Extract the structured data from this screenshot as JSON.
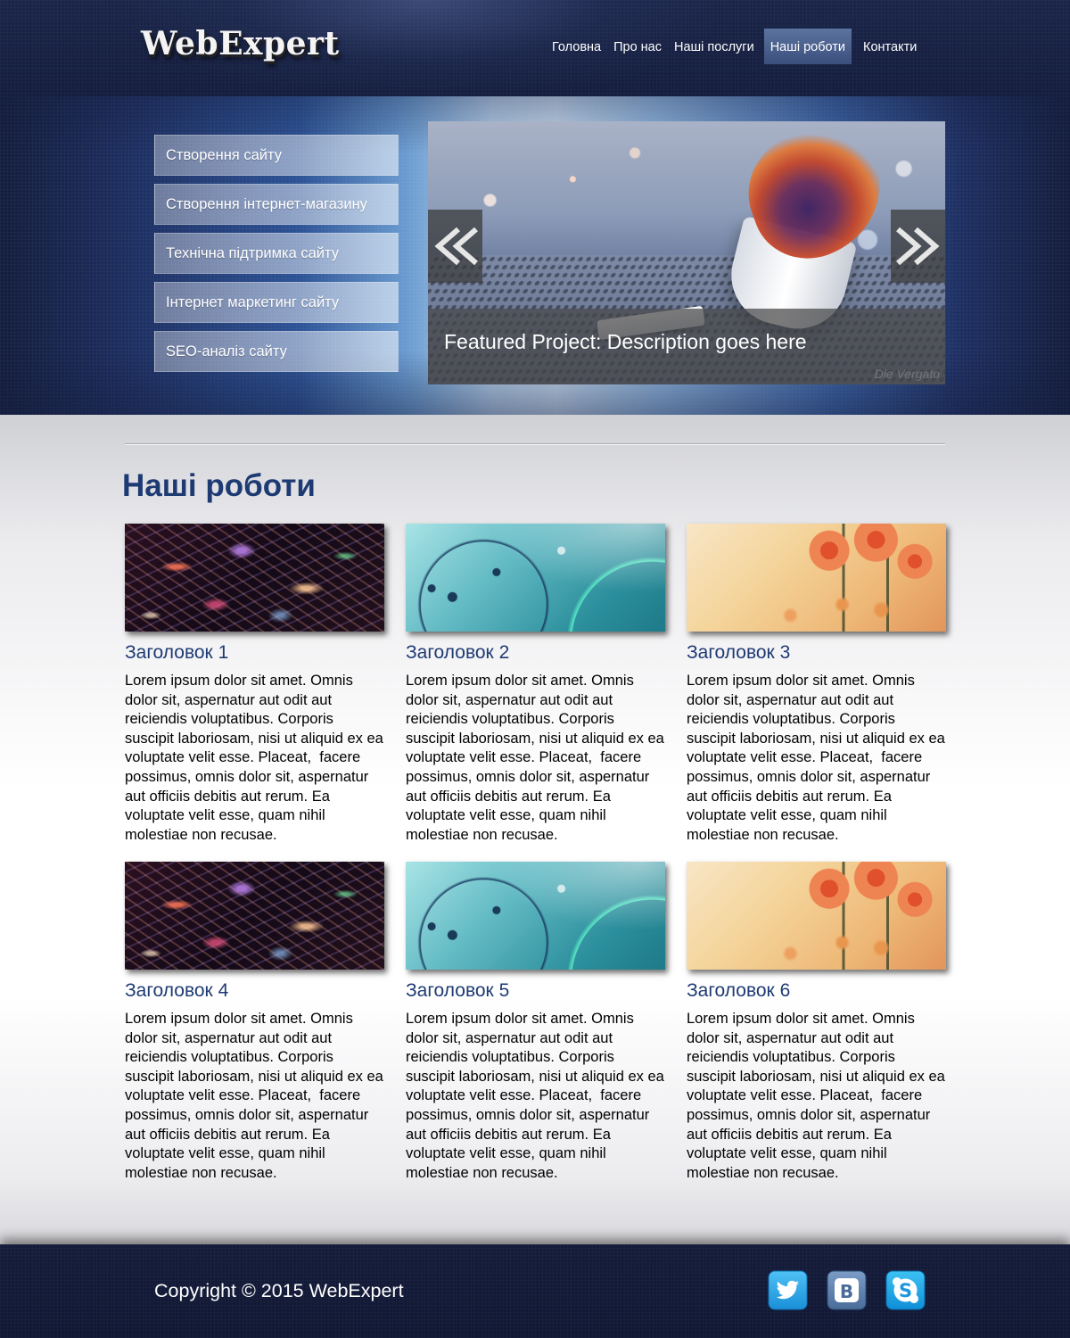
{
  "header": {
    "logo": "WebExpert",
    "nav": [
      {
        "label": "Головна"
      },
      {
        "label": "Про нас"
      },
      {
        "label": "Наші послуги"
      },
      {
        "label": "Наші роботи",
        "active": true
      },
      {
        "label": "Контакти"
      }
    ]
  },
  "services": [
    {
      "label": "Створення сайту"
    },
    {
      "label": "Створення інтернет-магазину"
    },
    {
      "label": "Технічна підтримка сайту"
    },
    {
      "label": "Інтернет маркетинг сайту"
    },
    {
      "label": "SEO-аналіз сайту"
    }
  ],
  "slider": {
    "caption": "Featured Project: Description goes here",
    "watermark": "Die Vergato",
    "prev_icon": "double-chevron-left-icon",
    "next_icon": "double-chevron-right-icon"
  },
  "main": {
    "title": "Наші роботи",
    "cards": [
      {
        "title": "Заголовок 1",
        "image": "cosmic-texture",
        "text": "Lorem ipsum dolor sit amet. Omnis dolor sit, aspernatur aut odit aut reiciendis voluptatibus. Corporis suscipit laboriosam, nisi ut aliquid ex ea voluptate velit esse. Placeat,  facere possimus, omnis dolor sit, aspernatur aut officiis debitis aut rerum. Ea voluptate velit esse, quam nihil molestiae non recusae."
      },
      {
        "title": "Заголовок 2",
        "image": "teal-floral",
        "text": "Lorem ipsum dolor sit amet. Omnis dolor sit, aspernatur aut odit aut reiciendis voluptatibus. Corporis suscipit laboriosam, nisi ut aliquid ex ea voluptate velit esse. Placeat,  facere possimus, omnis dolor sit, aspernatur aut officiis debitis aut rerum. Ea voluptate velit esse, quam nihil molestiae non recusae."
      },
      {
        "title": "Заголовок 3",
        "image": "orange-flowers",
        "text": "Lorem ipsum dolor sit amet. Omnis dolor sit, aspernatur aut odit aut reiciendis voluptatibus. Corporis suscipit laboriosam, nisi ut aliquid ex ea voluptate velit esse. Placeat,  facere possimus, omnis dolor sit, aspernatur aut officiis debitis aut rerum. Ea voluptate velit esse, quam nihil molestiae non recusae."
      },
      {
        "title": "Заголовок 4",
        "image": "cosmic-texture",
        "text": "Lorem ipsum dolor sit amet. Omnis dolor sit, aspernatur aut odit aut reiciendis voluptatibus. Corporis suscipit laboriosam, nisi ut aliquid ex ea voluptate velit esse. Placeat,  facere possimus, omnis dolor sit, aspernatur aut officiis debitis aut rerum. Ea voluptate velit esse, quam nihil molestiae non recusae."
      },
      {
        "title": "Заголовок 5",
        "image": "teal-floral",
        "text": "Lorem ipsum dolor sit amet. Omnis dolor sit, aspernatur aut odit aut reiciendis voluptatibus. Corporis suscipit laboriosam, nisi ut aliquid ex ea voluptate velit esse. Placeat,  facere possimus, omnis dolor sit, aspernatur aut officiis debitis aut rerum. Ea voluptate velit esse, quam nihil molestiae non recusae."
      },
      {
        "title": "Заголовок 6",
        "image": "orange-flowers",
        "text": "Lorem ipsum dolor sit amet. Omnis dolor sit, aspernatur aut odit aut reiciendis voluptatibus. Corporis suscipit laboriosam, nisi ut aliquid ex ea voluptate velit esse. Placeat,  facere possimus, omnis dolor sit, aspernatur aut officiis debitis aut rerum. Ea voluptate velit esse, quam nihil molestiae non recusae."
      }
    ]
  },
  "footer": {
    "copyright": "Copyright © 2015 WebExpert",
    "social": [
      {
        "icon": "twitter-icon"
      },
      {
        "icon": "vk-icon",
        "glyph": "B"
      },
      {
        "icon": "skype-icon",
        "glyph": "S"
      }
    ]
  },
  "colors": {
    "header_navy": "#141d3d",
    "accent_blue": "#1e3a73",
    "nav_active": "#4a6090",
    "social_blue": "#1c8fe0"
  }
}
